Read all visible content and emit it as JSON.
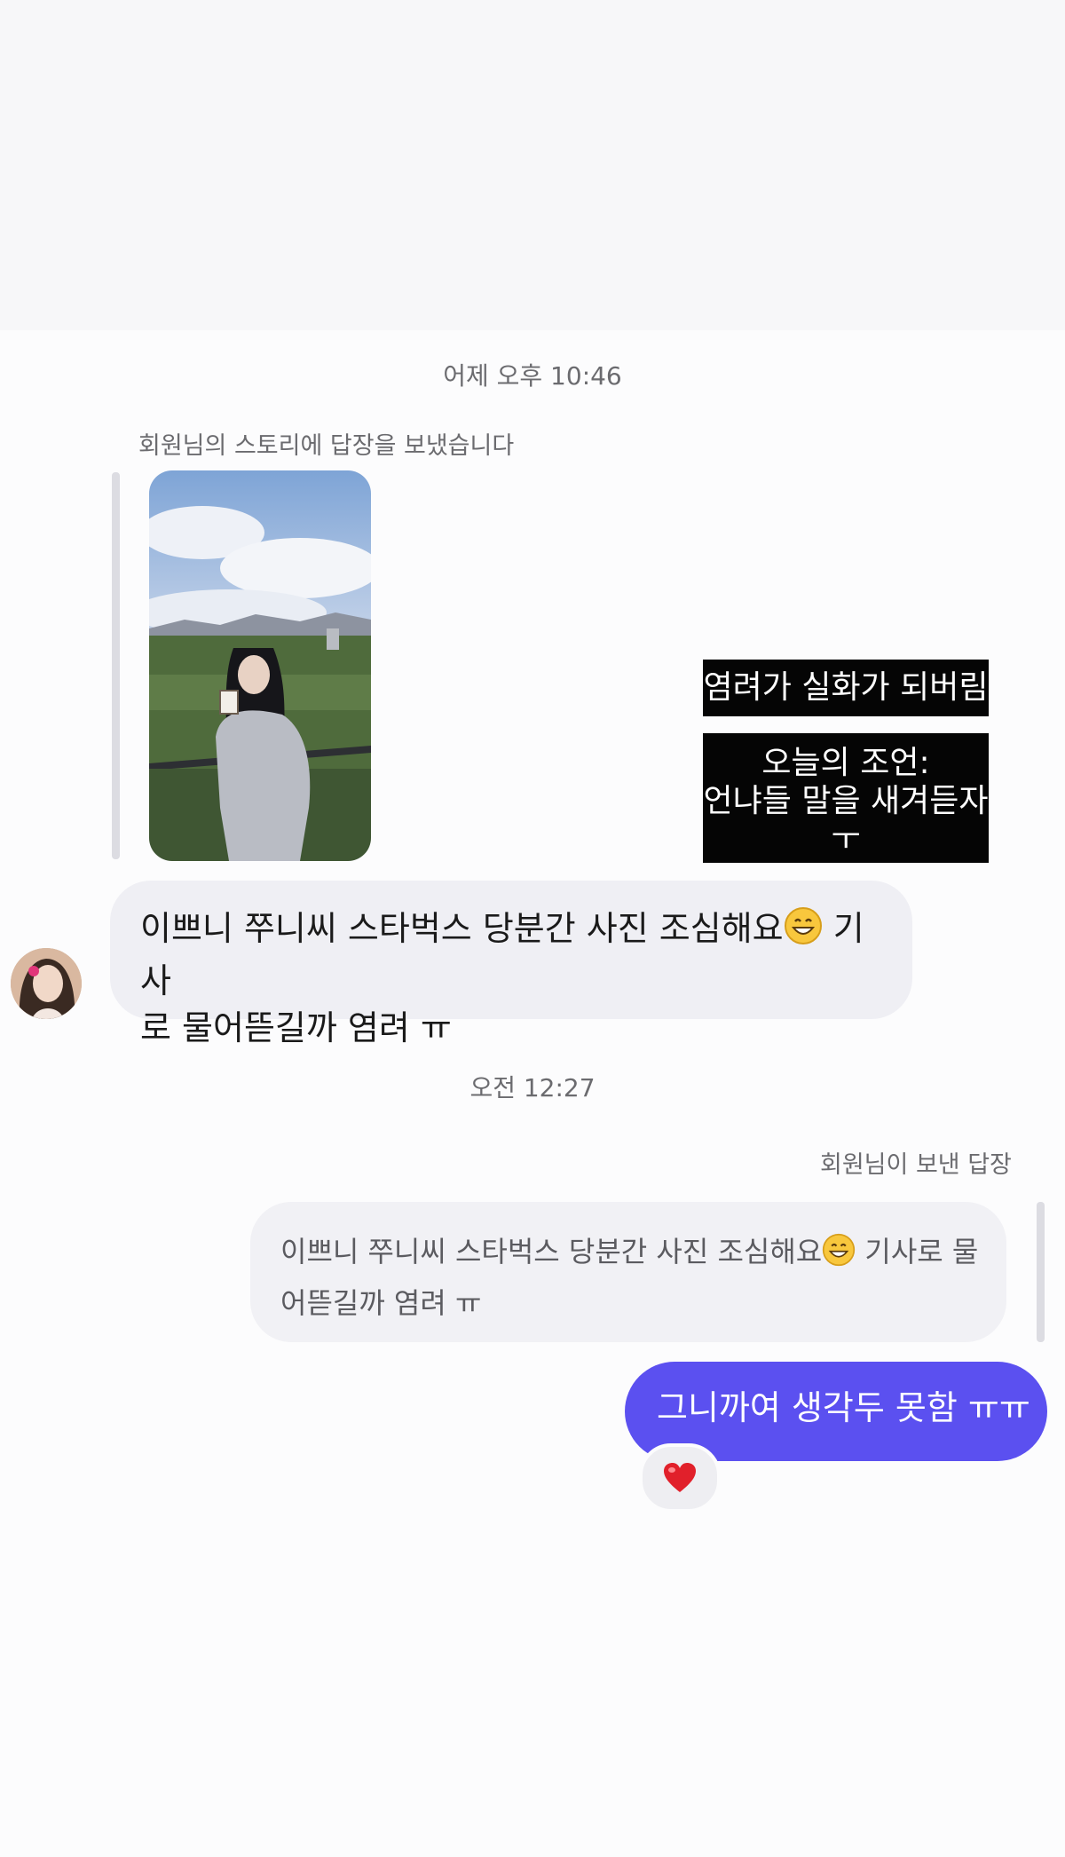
{
  "thread": {
    "timestamp_1": "어제 오후 10:46",
    "story_reply_note": "회원님의 스토리에 답장을 보냈습니다",
    "story": {
      "caption_line_1": "염려가 실화가 되버림",
      "caption_line_2": "오늘의 조언:",
      "caption_line_3": "언냐들 말을 새겨듣자",
      "caption_line_4": "ㅜ"
    },
    "received_message": {
      "text_before_emoji": "이쁘니 쭈니씨 스타벅스 당분간 사진 조심해요",
      "emoji": "grinning-face-emoji",
      "text_after_emoji_line1": " 기사",
      "text_line2": "로 물어뜯길까 염려 ㅠ"
    },
    "timestamp_2": "오전 12:27",
    "reply_note": "회원님이 보낸 답장",
    "quoted_message": {
      "text_before_emoji": "이쁘니 쭈니씨 스타벅스 당분간 사진 조심해요",
      "emoji": "grinning-face-emoji",
      "text_after_emoji_line1": " 기사로 물",
      "text_line2": "어뜯길까 염려 ㅠ"
    },
    "sent_message": "그니까여 생각두 못함 ㅠㅠ",
    "reaction": "heart-emoji",
    "colors": {
      "sent_bubble": "#5b50f0",
      "received_bubble": "#efeff4",
      "caption_bg": "#050505"
    }
  }
}
